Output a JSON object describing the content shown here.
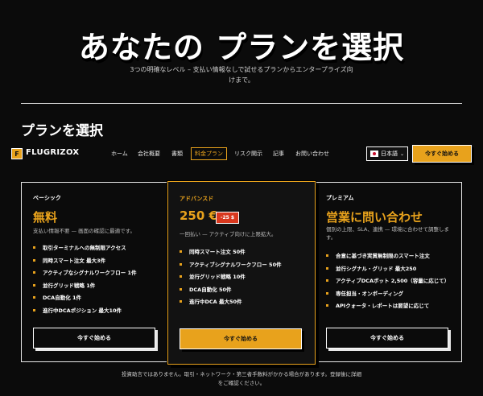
{
  "hero": {
    "title": "あなたの プランを選択",
    "subtitle": "3つの明確なレベル – 支払い情報なしで試せるプランからエンタープライズ向けまで。"
  },
  "section_title": "プランを選択",
  "nav": {
    "logo_letter": "F",
    "brand": "FLUGRIZOX",
    "items": [
      {
        "label": "ホーム"
      },
      {
        "label": "会社概要"
      },
      {
        "label": "書類"
      },
      {
        "label": "料金プラン"
      },
      {
        "label": "リスク開示"
      },
      {
        "label": "記事"
      },
      {
        "label": "お問い合わせ"
      }
    ],
    "active_item": "料金プラン",
    "language": "日本語",
    "cta": "今すぐ始める"
  },
  "plans": [
    {
      "tier": "ベーシック",
      "price": "無料",
      "description": "支払い情報不要 — 画面の確認に最適です。",
      "features": [
        "取引ターミナルへの無制限アクセス",
        "同時スマート注文 最大3件",
        "アクティブなシグナルワークフロー 1件",
        "並行グリッド戦略 1件",
        "DCA自動化 1件",
        "進行中DCAポジション 最大10件"
      ],
      "button": "今すぐ始める"
    },
    {
      "tier": "アドバンスド",
      "price": "250 €",
      "badge": "-25 $",
      "description": "一回払い — アクティブ向けに上限拡大。",
      "features": [
        "同時スマート注文 50件",
        "アクティブシグナルワークフロー 50件",
        "並行グリッド戦略 10件",
        "DCA自動化 50件",
        "進行中DCA 最大50件"
      ],
      "button": "今すぐ始める"
    },
    {
      "tier": "プレミアム",
      "price": "営業に問い合わせ",
      "description": "個別の上限、SLA、連携 — 環境に合わせて調整します。",
      "features": [
        "合意に基づき実質無制限のスマート注文",
        "並行シグナル・グリッド 最大250",
        "アクティブDCAボット 2,500（容量に応じて）",
        "専任担当・オンボーディング",
        "APIクォータ・レポートは要望に応じて"
      ],
      "button": "今すぐ始める"
    }
  ],
  "footer_note": "投資助言ではありません。取引・ネットワーク・第三者手数料がかかる場合があります。登録後に詳細をご確認ください。",
  "colors": {
    "accent": "#e8a21c",
    "background": "#0b0b0b",
    "badge": "#d9381e"
  }
}
